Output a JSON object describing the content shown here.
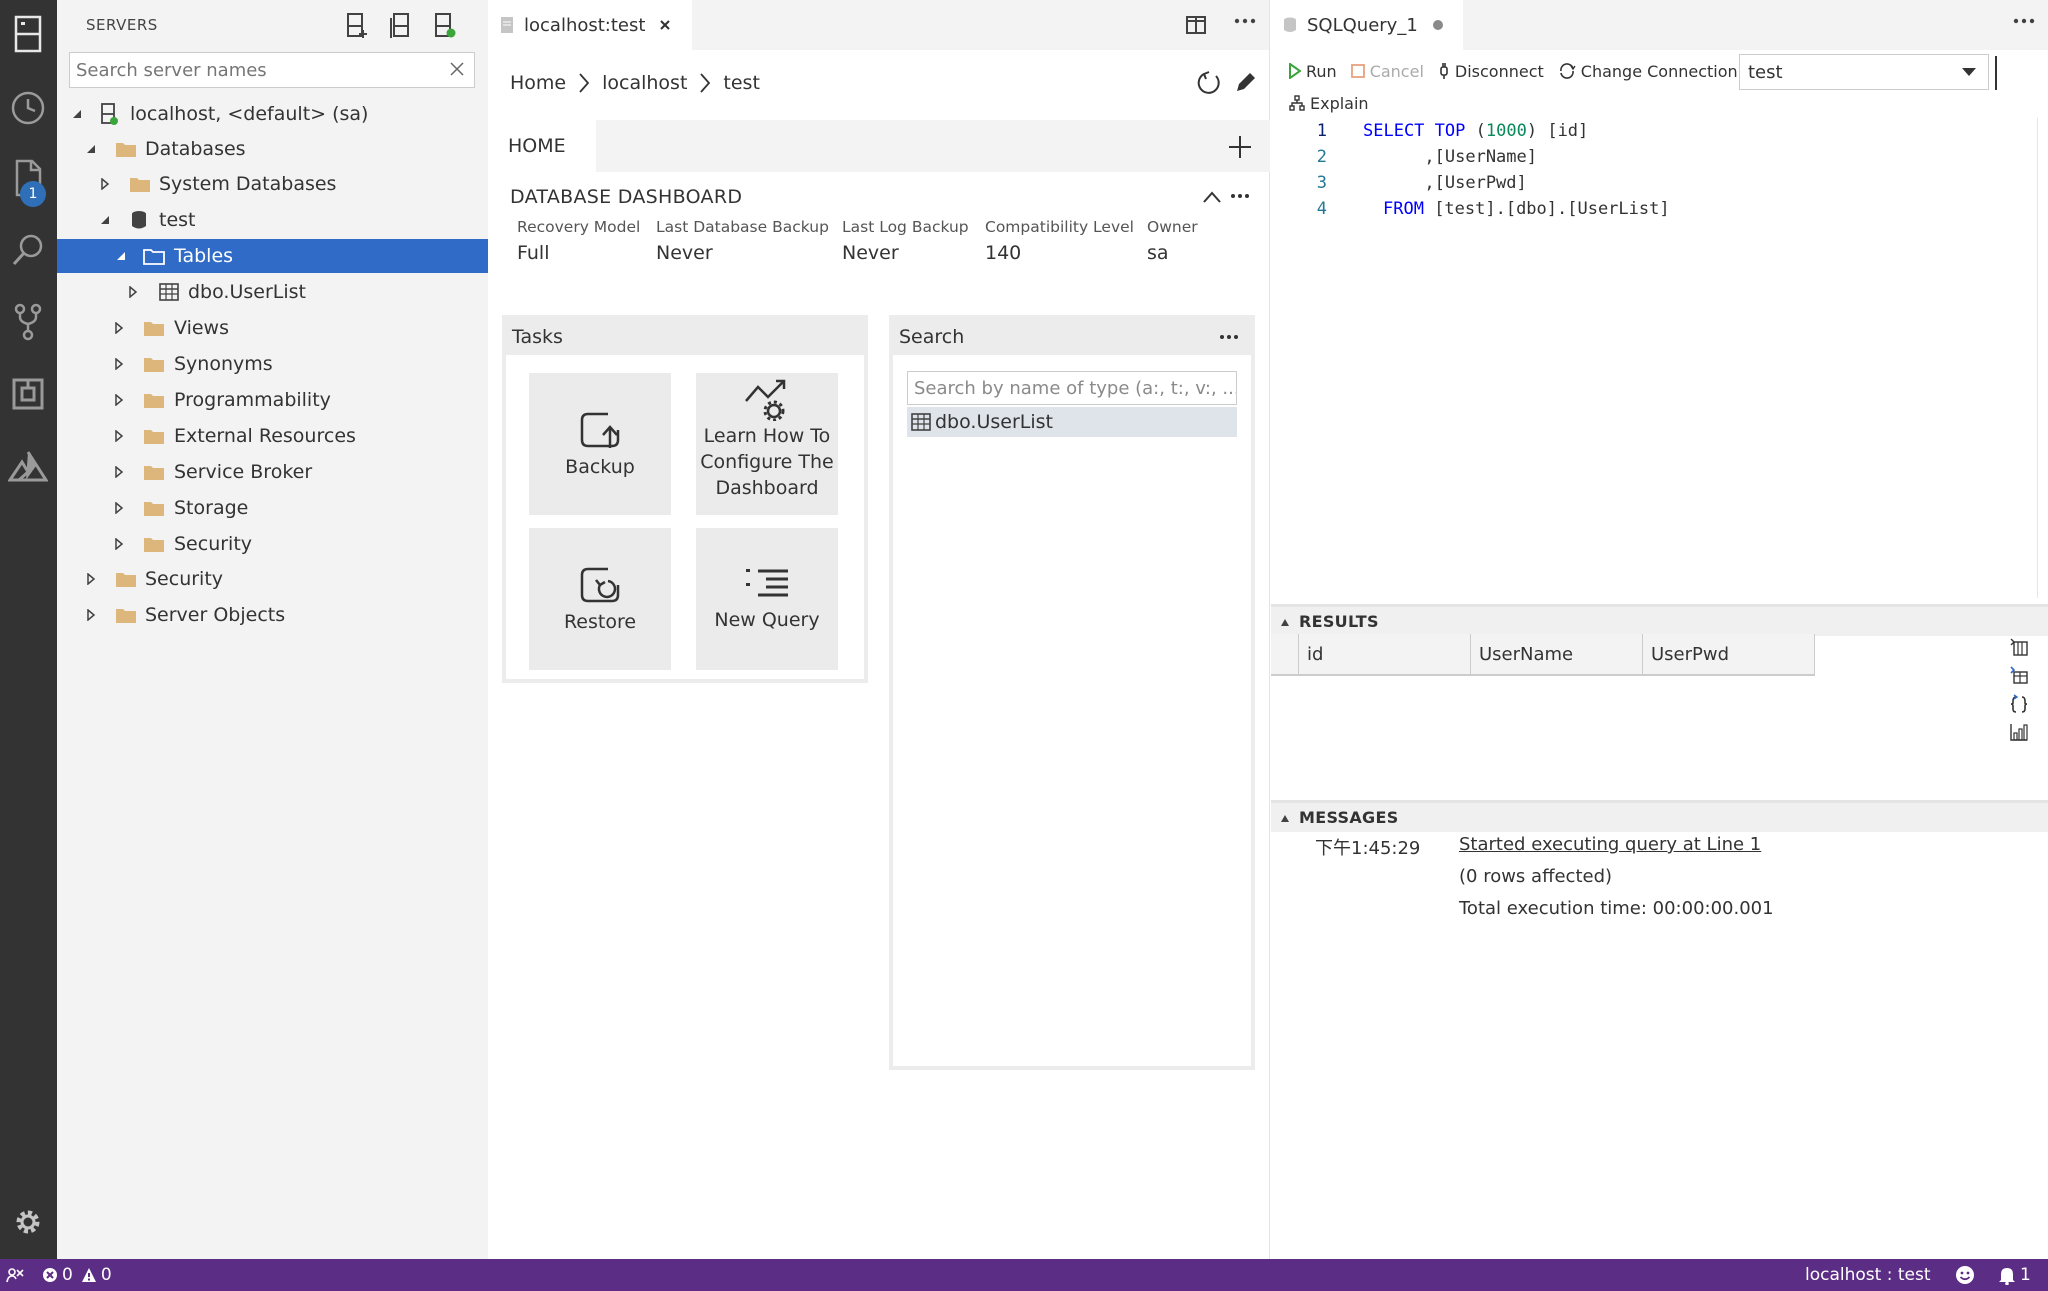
{
  "sidebar": {
    "title": "SERVERS",
    "search_placeholder": "Search server names",
    "tree": {
      "server": "localhost, <default> (sa)",
      "databases": "Databases",
      "system_databases": "System Databases",
      "db_test": "test",
      "tables": "Tables",
      "table_userlist": "dbo.UserList",
      "views": "Views",
      "synonyms": "Synonyms",
      "programmability": "Programmability",
      "external_resources": "External Resources",
      "service_broker": "Service Broker",
      "storage": "Storage",
      "db_security": "Security",
      "security": "Security",
      "server_objects": "Server Objects"
    }
  },
  "activity": {
    "badge": "1"
  },
  "dashboard": {
    "tab_title": "localhost:test",
    "breadcrumb": [
      "Home",
      "localhost",
      "test"
    ],
    "home_tab": "HOME",
    "title": "DATABASE DASHBOARD",
    "props": [
      {
        "label": "Recovery Model",
        "value": "Full"
      },
      {
        "label": "Last Database Backup",
        "value": "Never"
      },
      {
        "label": "Last Log Backup",
        "value": "Never"
      },
      {
        "label": "Compatibility Level",
        "value": "140"
      },
      {
        "label": "Owner",
        "value": "sa"
      }
    ],
    "tasks": {
      "title": "Tasks",
      "backup": "Backup",
      "learn": [
        "Learn How To",
        "Configure The",
        "Dashboard"
      ],
      "restore": "Restore",
      "new_query": "New Query"
    },
    "search": {
      "title": "Search",
      "placeholder": "Search by name of type (a:, t:, v:, ...",
      "result": "dbo.UserList"
    }
  },
  "query": {
    "tab_title": "SQLQuery_1",
    "toolbar": {
      "run": "Run",
      "cancel": "Cancel",
      "disconnect": "Disconnect",
      "change_connection": "Change Connection",
      "database": "test",
      "explain": "Explain"
    },
    "lines": [
      {
        "n": "1",
        "kw1": "SELECT",
        "kw2": "TOP",
        "num": "1000",
        "p1": "(",
        "p2": ")",
        "rest": " [id]"
      },
      {
        "n": "2",
        "text": "      ,[UserName]"
      },
      {
        "n": "3",
        "text": "      ,[UserPwd]"
      },
      {
        "n": "4",
        "kw": "FROM",
        "text": " [test].[dbo].[UserList]"
      }
    ],
    "results": {
      "title": "RESULTS",
      "columns": [
        "id",
        "UserName",
        "UserPwd"
      ]
    },
    "messages": {
      "title": "MESSAGES",
      "time": "下午1:45:29",
      "link": "Started executing query at Line 1",
      "rows": "(0 rows affected)",
      "total": "Total execution time: 00:00:00.001"
    }
  },
  "statusbar": {
    "errors": "0",
    "warnings": "0",
    "connection": "localhost : test",
    "notifications": "1"
  },
  "colors": {
    "activity_bar": "#333333",
    "selection": "#2f6bc7",
    "status_bar": "#5c2d84",
    "folder": "#dcb67a",
    "keyword": "#0000ff",
    "number": "#09885a"
  }
}
